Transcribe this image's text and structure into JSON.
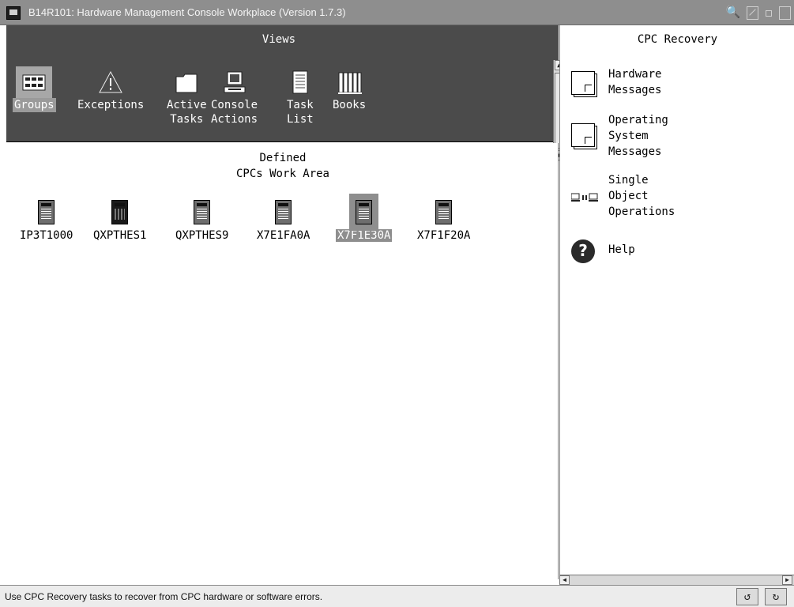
{
  "window": {
    "title": "B14R101: Hardware Management Console Workplace (Version 1.7.3)"
  },
  "views": {
    "title": "Views",
    "items": [
      {
        "label": "Groups",
        "icon": "groups-icon",
        "selected": true
      },
      {
        "label": "Exceptions",
        "icon": "exceptions-icon"
      },
      {
        "label": "Active\nTasks",
        "icon": "folder-icon"
      },
      {
        "label": "Console\nActions",
        "icon": "console-icon"
      },
      {
        "label": "Task\nList",
        "icon": "task-list-icon"
      },
      {
        "label": "Books",
        "icon": "books-icon"
      }
    ]
  },
  "work_area": {
    "title": "Defined\nCPCs Work Area",
    "cpcs": [
      {
        "label": "IP3T1000"
      },
      {
        "label": "QXPTHES1"
      },
      {
        "label": "QXPTHES9"
      },
      {
        "label": "X7E1FA0A"
      },
      {
        "label": "X7F1E30A",
        "selected": true
      },
      {
        "label": "X7F1F20A"
      }
    ]
  },
  "task_pane": {
    "title": "CPC Recovery",
    "tasks": [
      {
        "label": "Hardware\nMessages",
        "icon": "document-icon"
      },
      {
        "label": "Operating\nSystem\nMessages",
        "icon": "document-icon"
      },
      {
        "label": "Single\nObject\nOperations",
        "icon": "single-object-operations-icon"
      },
      {
        "label": "Help",
        "icon": "help-icon"
      }
    ]
  },
  "status_bar": {
    "text": "Use CPC Recovery tasks to recover from CPC hardware or software errors."
  },
  "colors": {
    "titlebar": "#8e8e8e",
    "views_background": "#4b4b4b",
    "selection": "#8e8e8e"
  }
}
